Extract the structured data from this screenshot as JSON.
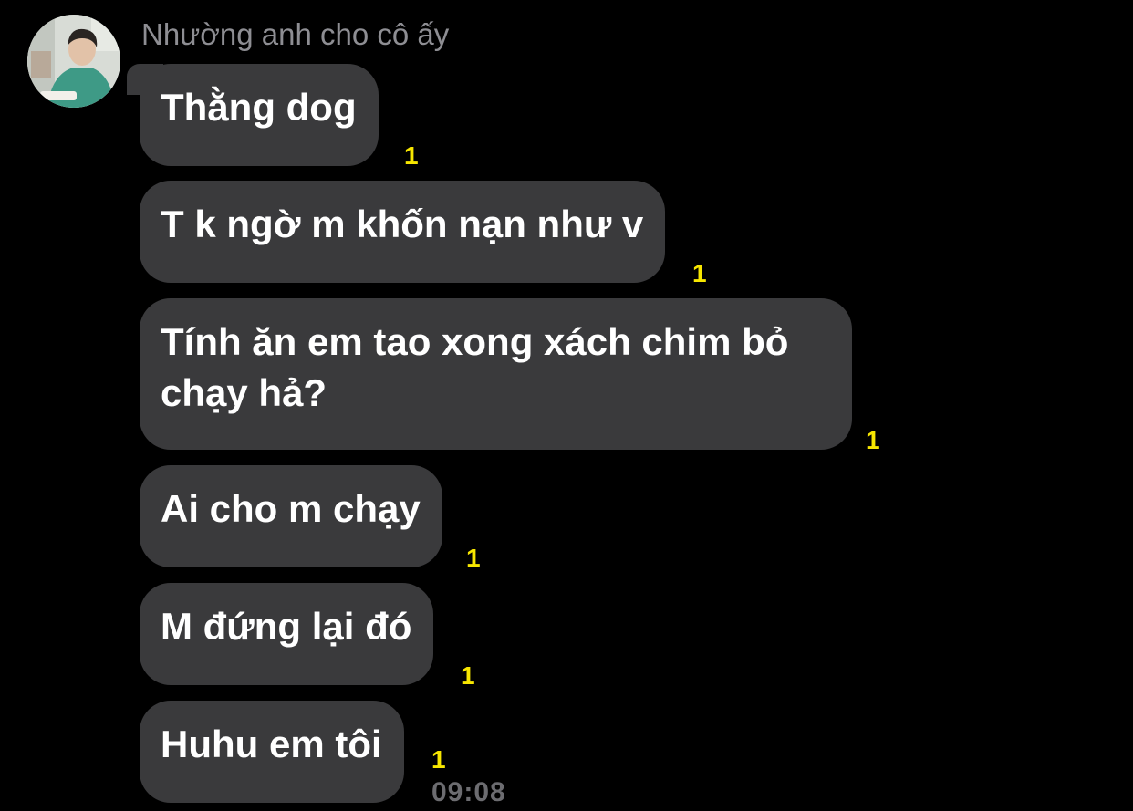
{
  "chat": {
    "sender_name": "Nhường anh cho cô ấy",
    "messages": [
      {
        "text": "Thằng dog",
        "unread": "1"
      },
      {
        "text": "T k ngờ m khốn nạn như v",
        "unread": "1"
      },
      {
        "text": "Tính ăn em tao xong xách chim bỏ chạy hả?",
        "unread": "1"
      },
      {
        "text": "Ai cho m chạy",
        "unread": "1"
      },
      {
        "text": "M đứng lại đó",
        "unread": "1"
      },
      {
        "text": "Huhu em tôi",
        "unread": "1"
      }
    ],
    "last_time": "09:08"
  },
  "colors": {
    "background": "#000000",
    "bubble": "#3a3a3c",
    "text": "#ffffff",
    "unread_count": "#f7e600",
    "meta_text": "#8e8e93"
  },
  "icons": {
    "avatar": "profile-photo"
  }
}
